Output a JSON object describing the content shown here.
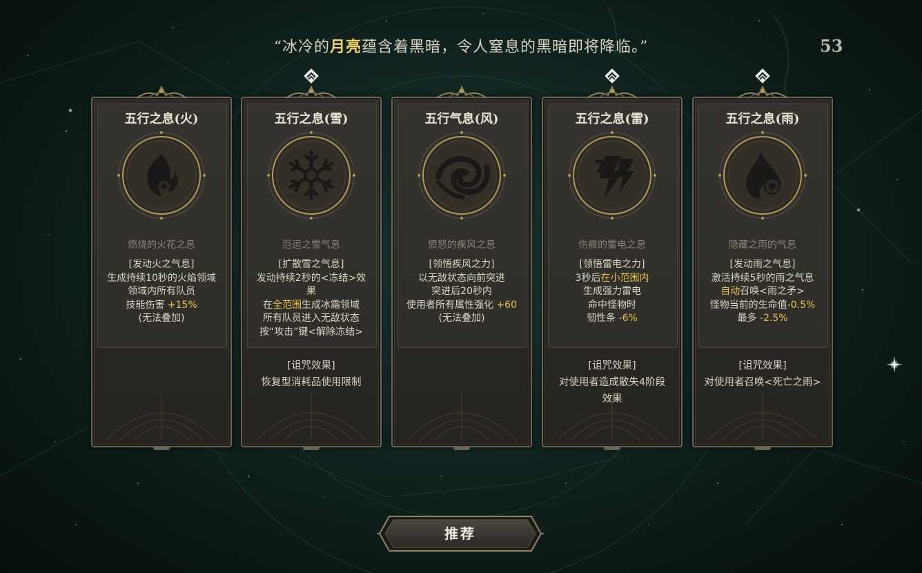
{
  "header": {
    "quote_open": "“冰冷的",
    "quote_highlight": "月亮",
    "quote_close": "蕴含着黑暗，令人窒息的黑暗即将降临。”",
    "timer": "53"
  },
  "colors": {
    "highlight": "#e8c34b",
    "text": "#ddd6c6",
    "subtitle": "#8a8476"
  },
  "cards": [
    {
      "title": "五行之息(火)",
      "icon": "fire-emblem-icon",
      "selected": false,
      "subtitle": "燃烧的火花之息",
      "lines": [
        [
          {
            "t": "[发动火之气息]"
          }
        ],
        [
          {
            "t": "生成持续10秒的火焰领域"
          }
        ],
        [
          {
            "t": "领域内所有队员"
          }
        ],
        [
          {
            "t": "技能伤害 "
          },
          {
            "t": "+15%",
            "hl": true
          }
        ],
        [
          {
            "t": "(无法叠加)"
          }
        ]
      ],
      "curse": []
    },
    {
      "title": "五行之息(雪)",
      "icon": "snowflake-emblem-icon",
      "selected": true,
      "subtitle": "厄运之雪气息",
      "lines": [
        [
          {
            "t": "[扩散雪之气息]"
          }
        ],
        [
          {
            "t": "发动持续2秒的<冻结>效"
          }
        ],
        [
          {
            "t": "果"
          }
        ],
        [
          {
            "t": "在"
          },
          {
            "t": "全范围",
            "hl": true
          },
          {
            "t": "生成冰霜领域"
          }
        ],
        [
          {
            "t": "所有队员进入无敌状态"
          }
        ],
        [
          {
            "t": "按“攻击”键<解除冻结>"
          }
        ]
      ],
      "curse": [
        "[诅咒效果]",
        "恢复型消耗品使用限制"
      ]
    },
    {
      "title": "五行气息(风)",
      "icon": "wind-emblem-icon",
      "selected": false,
      "subtitle": "愤怒的疾风之息",
      "lines": [
        [
          {
            "t": "[领悟疾风之力]"
          }
        ],
        [
          {
            "t": "以无敌状态向前突进"
          }
        ],
        [
          {
            "t": "突进后20秒内"
          }
        ],
        [
          {
            "t": "使用者所有属性强化 "
          },
          {
            "t": "+60",
            "hl": true
          }
        ],
        [
          {
            "t": "(无法叠加)"
          }
        ]
      ],
      "curse": []
    },
    {
      "title": "五行之息(雷)",
      "icon": "lightning-emblem-icon",
      "selected": true,
      "subtitle": "伤痕的雷电之息",
      "lines": [
        [
          {
            "t": "[领悟雷电之力]"
          }
        ],
        [
          {
            "t": "3秒后"
          },
          {
            "t": "在小范围内",
            "hl": true
          }
        ],
        [
          {
            "t": "生成强力雷电"
          }
        ],
        [
          {
            "t": "命中怪物时"
          }
        ],
        [
          {
            "t": "韧性条 "
          },
          {
            "t": "-6%",
            "hl": true
          }
        ]
      ],
      "curse": [
        "[诅咒效果]",
        "对使用者造成散失4阶段",
        "效果"
      ]
    },
    {
      "title": "五行之息(雨)",
      "icon": "rain-emblem-icon",
      "selected": true,
      "subtitle": "隐藏之雨的气息",
      "lines": [
        [
          {
            "t": "[发动雨之气息]"
          }
        ],
        [
          {
            "t": "激活持续5秒的雨之气息"
          }
        ],
        [
          {
            "t": "自动",
            "hl": true
          },
          {
            "t": "召唤<雨之矛>"
          }
        ],
        [
          {
            "t": "怪物当前的生命值"
          },
          {
            "t": "-0.5%",
            "hl": true
          }
        ],
        [
          {
            "t": "最多 "
          },
          {
            "t": "-2.5%",
            "hl": true
          }
        ]
      ],
      "curse": [
        "[诅咒效果]",
        "对使用者召唤<死亡之雨>"
      ]
    }
  ],
  "recommend_button": {
    "label": "推荐"
  }
}
